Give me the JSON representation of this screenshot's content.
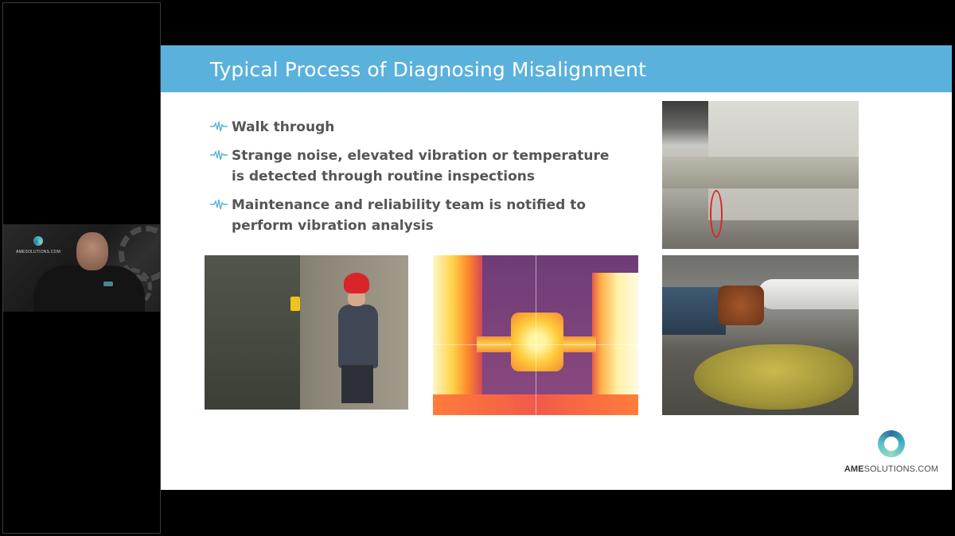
{
  "slide": {
    "title": "Typical Process of Diagnosing Misalignment",
    "header_color": "#5ab1dc",
    "bullets": [
      {
        "text": "Walk through",
        "icon": "waveform-icon"
      },
      {
        "text": "Strange noise, elevated vibration or temperature is detected through routine inspections",
        "icon": "waveform-icon"
      },
      {
        "text": "Maintenance and reliability team is notified to perform vibration analysis",
        "icon": "waveform-icon"
      }
    ],
    "images": [
      {
        "name": "photo-pipe-crack",
        "icon": "cracked-foundation-photo"
      },
      {
        "name": "photo-technician",
        "icon": "technician-with-thermometer-photo"
      },
      {
        "name": "photo-thermal",
        "icon": "thermal-image-photo"
      },
      {
        "name": "photo-leak",
        "icon": "pump-leak-photo"
      }
    ],
    "brand": {
      "name_bold": "AME",
      "name_rest": "SOLUTIONS.COM"
    }
  },
  "webcam": {
    "logo_text": "AMESOLUTIONS.COM"
  }
}
